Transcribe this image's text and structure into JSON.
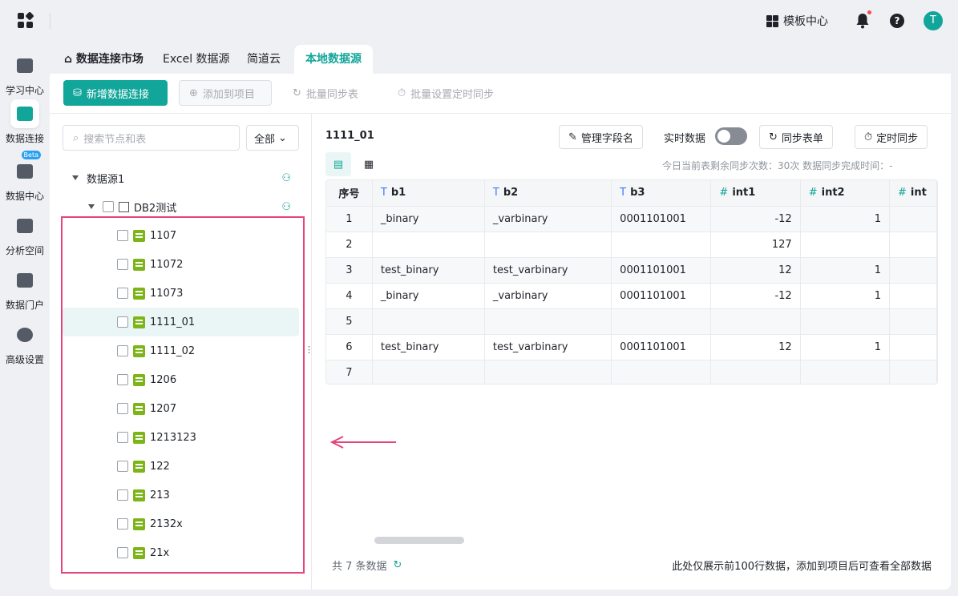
{
  "header": {
    "template_center": "模板中心",
    "avatar_initial": "T"
  },
  "sidenav": [
    {
      "label": "学习中心"
    },
    {
      "label": "数据连接"
    },
    {
      "label": "数据中心",
      "badge": "Beta"
    },
    {
      "label": "分析空间"
    },
    {
      "label": "数据门户"
    },
    {
      "label": "高级设置"
    }
  ],
  "tabs": [
    "数据连接市场",
    "Excel 数据源",
    "简道云",
    "本地数据源"
  ],
  "toolbar": {
    "new_connection": "新增数据连接",
    "add_to_project": "添加到项目",
    "batch_sync": "批量同步表",
    "batch_schedule": "批量设置定时同步"
  },
  "left": {
    "search_placeholder": "搜索节点和表",
    "filter": "全部",
    "source": "数据源1",
    "db": "DB2测试",
    "tables": [
      "1107",
      "11072",
      "11073",
      "1111_01",
      "1111_02",
      "1206",
      "1207",
      "1213123",
      "122",
      "213",
      "2132x",
      "21x"
    ]
  },
  "right": {
    "title": "1111_01",
    "manage_fields": "管理字段名",
    "realtime": "实时数据",
    "sync_table": "同步表单",
    "schedule_sync": "定时同步",
    "info": "今日当前表剩余同步次数：30次    数据同步完成时间：-",
    "columns": [
      "序号",
      "b1",
      "b2",
      "b3",
      "int1",
      "int2",
      "int"
    ],
    "rows": [
      [
        "1",
        "_binary",
        "_varbinary",
        "0001101001",
        "-12",
        "1",
        ""
      ],
      [
        "2",
        "",
        "",
        "",
        "127",
        "",
        ""
      ],
      [
        "3",
        "test_binary",
        "test_varbinary",
        "0001101001",
        "12",
        "1",
        ""
      ],
      [
        "4",
        "_binary",
        "_varbinary",
        "0001101001",
        "-12",
        "1",
        ""
      ],
      [
        "5",
        "",
        "",
        "",
        "",
        "",
        ""
      ],
      [
        "6",
        "test_binary",
        "test_varbinary",
        "0001101001",
        "12",
        "1",
        ""
      ],
      [
        "7",
        "",
        "",
        "",
        "",
        "",
        ""
      ]
    ],
    "count_text": "共 7 条数据",
    "note": "此处仅展示前100行数据，添加到项目后可查看全部数据"
  },
  "colors": {
    "accent": "#12a69a",
    "highlight": "#e5457a",
    "table_icon": "#7cb518"
  }
}
